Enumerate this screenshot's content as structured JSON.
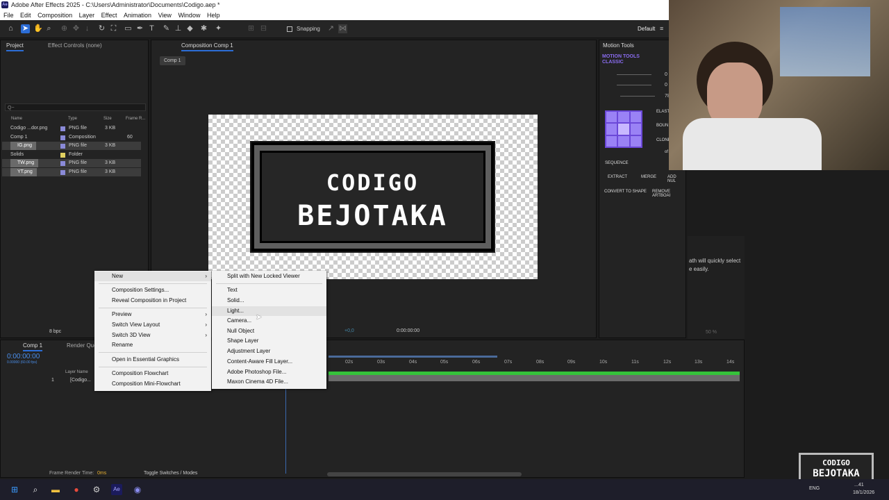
{
  "window": {
    "title": "Adobe After Effects 2025 - C:\\Users\\Administrator\\Documents\\Codigo.aep *",
    "app_badge": "Ae"
  },
  "menubar": [
    "File",
    "Edit",
    "Composition",
    "Layer",
    "Effect",
    "Animation",
    "View",
    "Window",
    "Help"
  ],
  "toolbar": {
    "snapping_label": "Snapping",
    "workspace": "Default"
  },
  "project_panel": {
    "tab": "Project",
    "effect_controls": "Effect Controls (none)",
    "search_placeholder": "Q~",
    "columns": [
      "Name",
      "Type",
      "Size",
      "Frame R..."
    ],
    "items": [
      {
        "name": "Codigo ...dor.png",
        "type": "PNG file",
        "size": "3 KB",
        "fr": "",
        "color": "#8a8ad8",
        "hl": false
      },
      {
        "name": "Comp 1",
        "type": "Composition",
        "size": "",
        "fr": "60",
        "color": "#8a8ad8",
        "hl": false
      },
      {
        "name": "IG.png",
        "type": "PNG file",
        "size": "3 KB",
        "fr": "",
        "color": "#8a8ad8",
        "hl": true
      },
      {
        "name": "Solids",
        "type": "Folder",
        "size": "",
        "fr": "",
        "color": "#e0d060",
        "hl": false
      },
      {
        "name": "TW.png",
        "type": "PNG file",
        "size": "3 KB",
        "fr": "",
        "color": "#8a8ad8",
        "hl": true
      },
      {
        "name": "YT.png",
        "type": "PNG file",
        "size": "3 KB",
        "fr": "",
        "color": "#8a8ad8",
        "hl": true
      }
    ],
    "bpc": "8 bpc"
  },
  "composition_panel": {
    "tab": "Composition Comp 1",
    "breadcrumb": "Comp 1",
    "logo_line1": "CODIGO",
    "logo_line2": "BEJOTAKA",
    "exposure": "+0,0",
    "timecode": "0:00:00:00"
  },
  "context_menu": {
    "items": [
      {
        "label": "New",
        "arrow": true
      },
      {
        "label": "Composition Settings...",
        "arrow": false
      },
      {
        "label": "Reveal Composition in Project",
        "arrow": false
      },
      {
        "label": "Preview",
        "arrow": true
      },
      {
        "label": "Switch View Layout",
        "arrow": true
      },
      {
        "label": "Switch 3D View",
        "arrow": true
      },
      {
        "label": "Rename",
        "arrow": false
      },
      {
        "label": "Open in Essential Graphics",
        "arrow": false
      },
      {
        "label": "Composition Flowchart",
        "arrow": false
      },
      {
        "label": "Composition Mini-Flowchart",
        "arrow": false
      }
    ]
  },
  "submenu": {
    "items": [
      "Split with New Locked Viewer",
      "Text",
      "Solid...",
      "Light...",
      "Camera...",
      "Null Object",
      "Shape Layer",
      "Adjustment Layer",
      "Content-Aware Fill Layer...",
      "Adobe Photoshop File...",
      "Maxon Cinema 4D File..."
    ],
    "hovered": "Light..."
  },
  "timeline": {
    "tab": "Comp 1",
    "render_queue": "Render Queue",
    "timecode": "0:00:00:00",
    "fps": "0.00000 (60.00 fps)",
    "layer_header": "Layer Name",
    "layer_number": "1",
    "layer_name": "[Codigo...",
    "ticks": [
      "02s",
      "03s",
      "04s",
      "05s",
      "06s",
      "07s",
      "08s",
      "09s",
      "10s",
      "11s",
      "12s",
      "13s",
      "14s"
    ],
    "footer_render": "Frame Render Time:",
    "footer_render_value": "0ms",
    "footer_toggle": "Toggle Switches / Modes"
  },
  "motion_tools": {
    "tab": "Motion Tools",
    "title1": "MOTION TOOLS",
    "title2": "CLASSIC",
    "vals": [
      "0",
      "0",
      "78"
    ],
    "side": [
      "ELAST",
      "BOUN",
      "CLONE",
      "of"
    ],
    "sequence": "SEQUENCE",
    "extract": "EXTRACT",
    "merge": "MERGE",
    "add_null": "ADD NUL",
    "convert": "CONVERT TO SHAPE",
    "remove": "REMOVE ARTBOAI",
    "zoom": "50 %"
  },
  "help_text": {
    "line1": "ath will quickly select",
    "line2": "e easily."
  },
  "watermark": {
    "line1": "CODIGO",
    "line2": "BEJOTAKA"
  },
  "taskbar": {
    "lang": "ENG",
    "time": "...41",
    "date": "18/1/2026"
  },
  "colors": {
    "accent": "#2c6dd6",
    "purple": "#8a6cf0",
    "green_bar": "#35c23a"
  }
}
